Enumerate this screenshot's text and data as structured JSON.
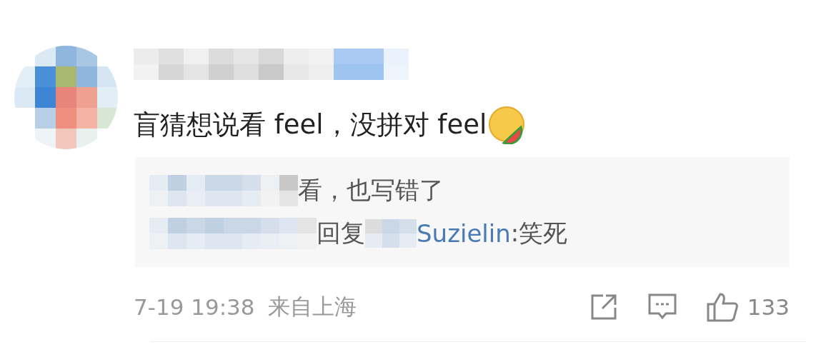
{
  "comment": {
    "text": "盲猜想说看 feel，没拼对 feel",
    "replies": [
      {
        "kind": "text",
        "text": "看，也写错了"
      },
      {
        "kind": "reply",
        "prefix": "回复",
        "mention": "Suzielin",
        "text": ":笑死"
      }
    ],
    "time": "7-19 19:38",
    "location": "来自上海",
    "likes": "133"
  }
}
